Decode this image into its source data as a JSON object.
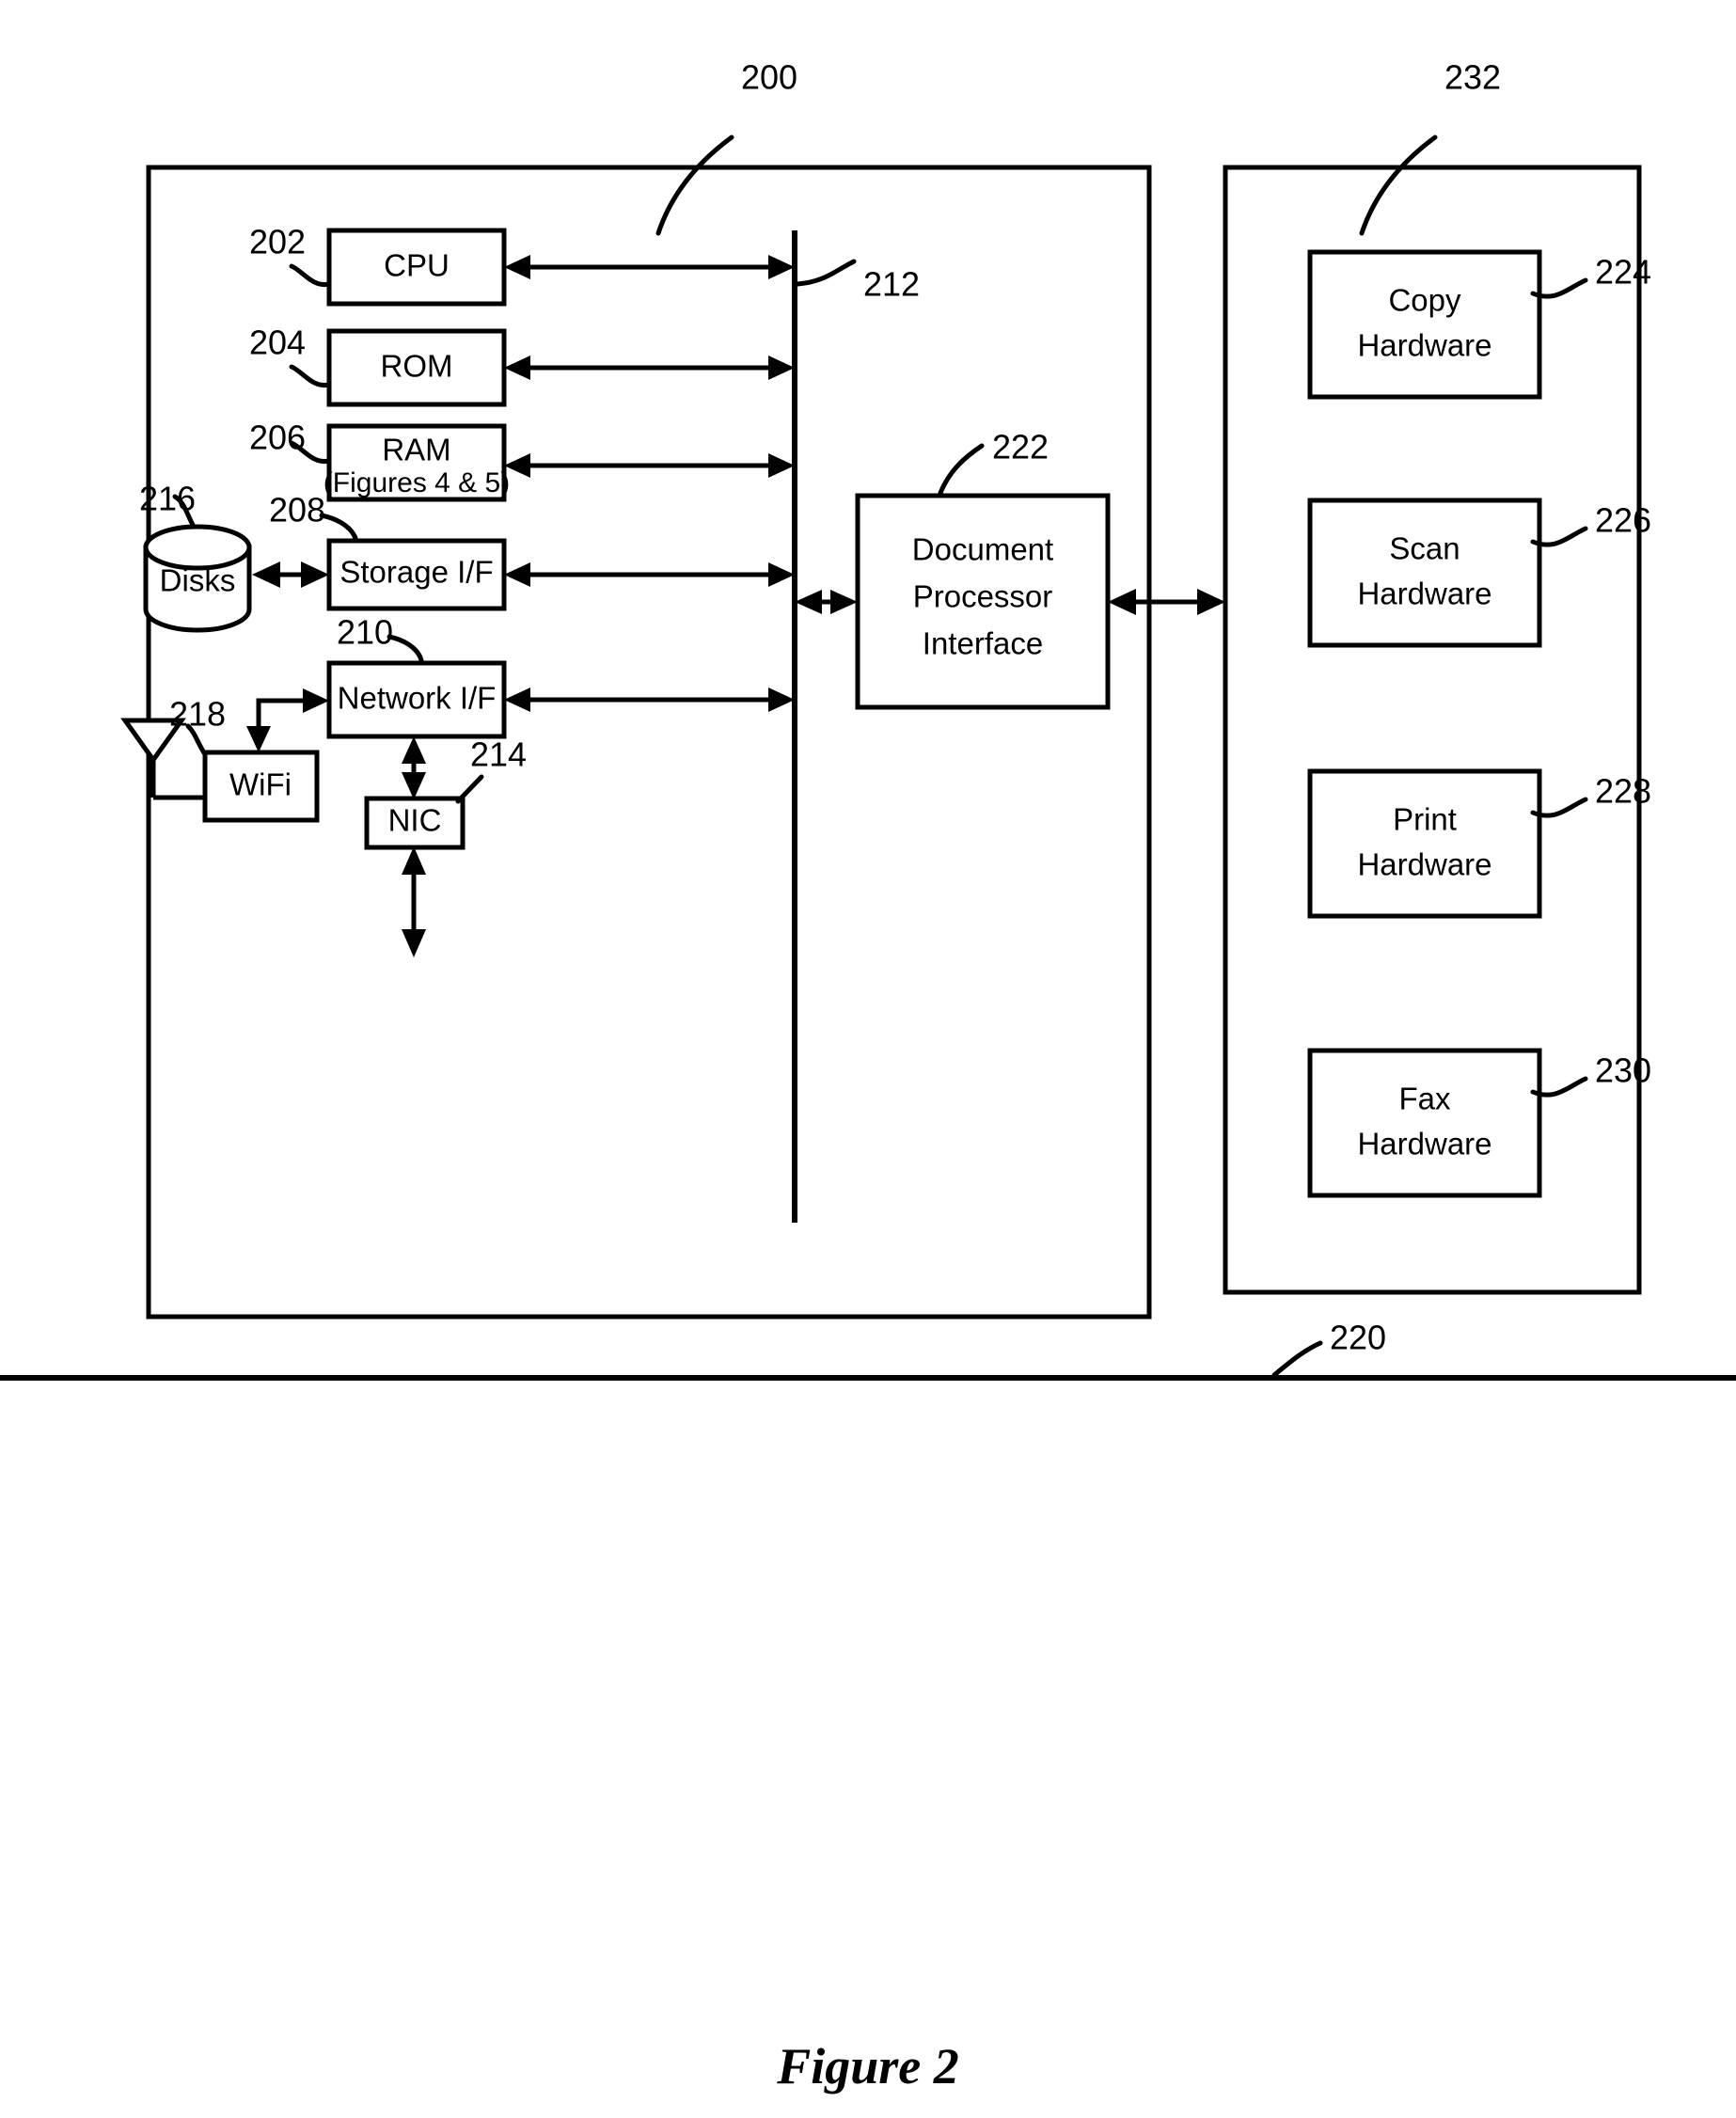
{
  "figure": {
    "caption": "Figure 2",
    "title_ref": "200"
  },
  "reference_numerals": {
    "system": "200",
    "cpu": "202",
    "rom": "204",
    "ram": "206",
    "storage_if": "208",
    "network_if": "210",
    "bus": "212",
    "nic": "214",
    "disks": "216",
    "wifi": "218",
    "network": "220",
    "document_processor_interface": "222",
    "copy_hardware": "224",
    "scan_hardware": "226",
    "print_hardware": "228",
    "fax_hardware": "230",
    "document_processor": "232"
  },
  "left_block": {
    "ref": "200",
    "components": [
      {
        "id": "cpu",
        "ref": "202",
        "label": "CPU",
        "lines": [
          "CPU"
        ]
      },
      {
        "id": "rom",
        "ref": "204",
        "label": "ROM",
        "lines": [
          "ROM"
        ]
      },
      {
        "id": "ram",
        "ref": "206",
        "label": "RAM (Figures 4 & 5)",
        "lines": [
          "RAM",
          "(Figures 4 & 5)"
        ]
      },
      {
        "id": "storage-if",
        "ref": "208",
        "label": "Storage I/F",
        "lines": [
          "Storage I/F"
        ]
      },
      {
        "id": "network-if",
        "ref": "210",
        "label": "Network I/F",
        "lines": [
          "Network I/F"
        ]
      },
      {
        "id": "nic",
        "ref": "214",
        "label": "NIC",
        "lines": [
          "NIC"
        ]
      },
      {
        "id": "disks",
        "ref": "216",
        "label": "Disks",
        "lines": [
          "Disks"
        ]
      },
      {
        "id": "wifi",
        "ref": "218",
        "label": "WiFi",
        "lines": [
          "WiFi"
        ]
      },
      {
        "id": "bus",
        "ref": "212",
        "label": "",
        "lines": []
      }
    ],
    "document_processor_interface": {
      "ref": "222",
      "label": "Document Processor Interface",
      "lines": [
        "Document",
        "Processor",
        "Interface"
      ]
    }
  },
  "right_block": {
    "ref": "232",
    "components": [
      {
        "id": "copy-hardware",
        "ref": "224",
        "label": "Copy Hardware",
        "lines": [
          "Copy",
          "Hardware"
        ]
      },
      {
        "id": "scan-hardware",
        "ref": "226",
        "label": "Scan Hardware",
        "lines": [
          "Scan",
          "Hardware"
        ]
      },
      {
        "id": "print-hardware",
        "ref": "228",
        "label": "Print Hardware",
        "lines": [
          "Print",
          "Hardware"
        ]
      },
      {
        "id": "fax-hardware",
        "ref": "230",
        "label": "Fax Hardware",
        "lines": [
          "Fax",
          "Hardware"
        ]
      }
    ]
  },
  "network_bus": {
    "ref": "220",
    "label": ""
  },
  "colors": {
    "stroke": "#000000",
    "fill": "#ffffff",
    "background": "#ffffff"
  }
}
